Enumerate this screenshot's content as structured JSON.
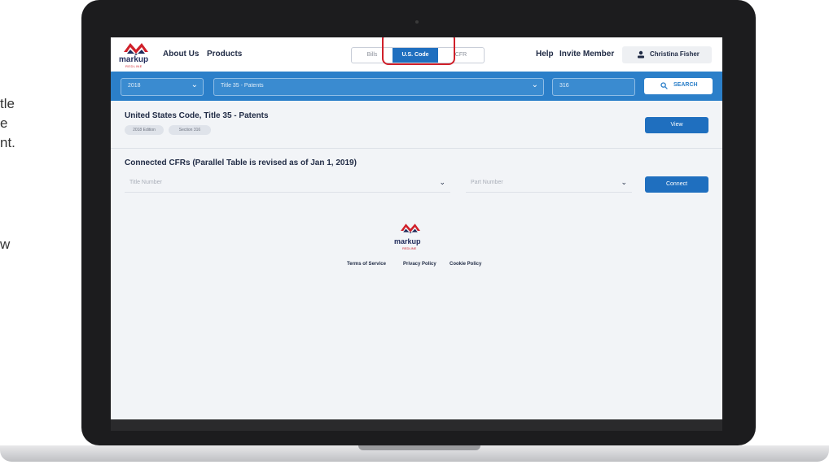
{
  "side_text": [
    "tle",
    "e",
    "nt.",
    "w"
  ],
  "nav": {
    "logo_word": "markup",
    "logo_sub": "REDLINE",
    "about": "About Us",
    "products": "Products",
    "tabs": [
      {
        "label": "Bills",
        "active": false
      },
      {
        "label": "U.S. Code",
        "active": true
      },
      {
        "label": "CFR",
        "active": false
      }
    ],
    "help": "Help",
    "invite": "Invite Member",
    "user_name": "Christina Fisher"
  },
  "search": {
    "year": "2018",
    "title": "Title 35 - Patents",
    "section": "316",
    "button": "SEARCH"
  },
  "result": {
    "title": "United States Code, Title 35 - Patents",
    "pills": [
      "2018 Edition",
      "Section 316"
    ],
    "view_button": "View"
  },
  "connected": {
    "heading": "Connected CFRs (Parallel Table is revised as of Jan 1, 2019)",
    "title_placeholder": "Title Number",
    "part_placeholder": "Part Number",
    "connect_button": "Connect"
  },
  "footer": {
    "logo_word": "markup",
    "logo_sub": "REDLINE",
    "links": [
      "Terms of Service",
      "Privacy Policy",
      "Cookie Policy"
    ]
  },
  "colors": {
    "brand_blue": "#2b7fc9",
    "button_blue": "#1f6fbf",
    "logo_red": "#d0202a",
    "logo_navy": "#1f2a5a"
  }
}
